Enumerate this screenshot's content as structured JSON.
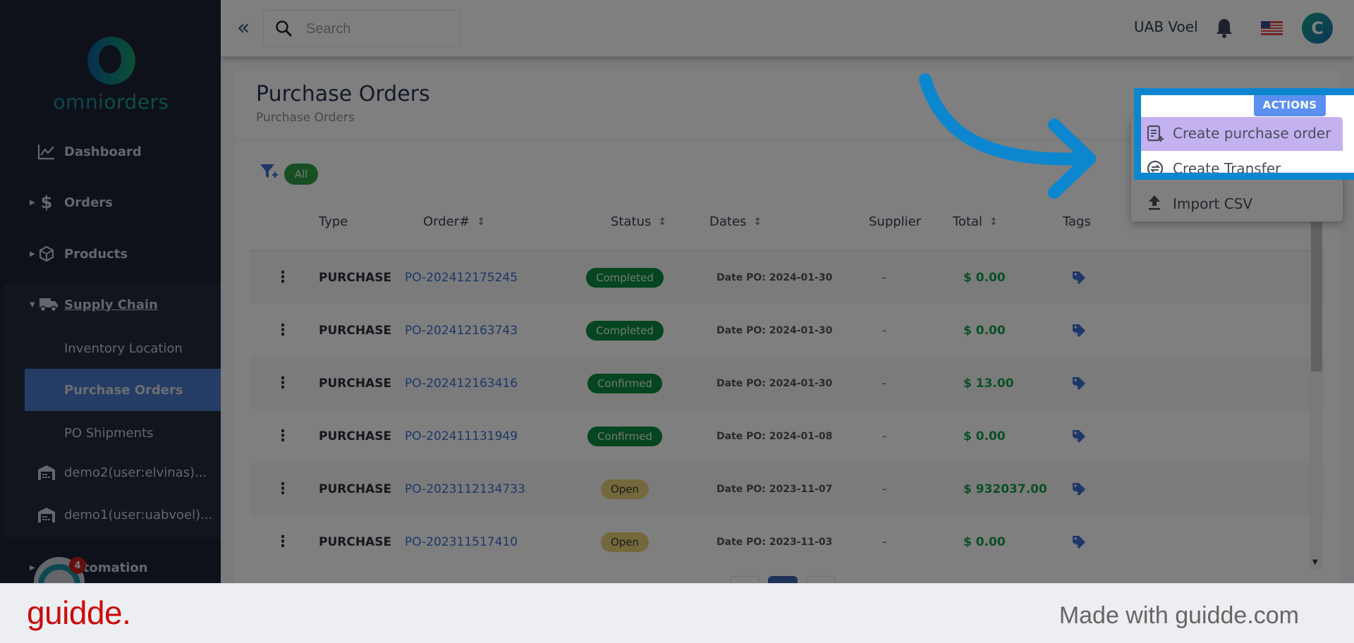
{
  "brand": {
    "logo_text_part1": "omni",
    "logo_text_part2": "orders"
  },
  "sidebar": {
    "items": [
      {
        "label": "Dashboard",
        "icon": "chart-line-icon"
      },
      {
        "label": "Orders",
        "icon": "dollar-icon"
      },
      {
        "label": "Products",
        "icon": "box-icon"
      },
      {
        "label": "Supply Chain",
        "icon": "truck-icon"
      },
      {
        "label": "Automation",
        "icon": "automation-icon"
      }
    ],
    "supply_chain_sub": [
      {
        "label": "Inventory Location"
      },
      {
        "label": "Purchase Orders",
        "active": true
      },
      {
        "label": "PO Shipments"
      },
      {
        "label": "demo2(user:elvinas)...",
        "icon": "warehouse-icon"
      },
      {
        "label": "demo1(user:uabvoel)...",
        "icon": "warehouse-icon"
      }
    ],
    "automation_badge": "4"
  },
  "topbar": {
    "search_placeholder": "Search",
    "user_name": "UAB Voel",
    "avatar_initial": "C",
    "language_flag": "us-flag"
  },
  "page": {
    "title": "Purchase Orders",
    "breadcrumb": "Purchase Orders",
    "filter_chip": "All",
    "actions_label": "ACTIONS"
  },
  "actions_menu": [
    {
      "label": "Create purchase order",
      "icon": "create-document-icon",
      "highlighted": true
    },
    {
      "label": "Create Transfer",
      "icon": "transfer-icon"
    },
    {
      "label": "Import CSV",
      "icon": "upload-icon"
    }
  ],
  "table": {
    "columns": [
      "Type",
      "Order#",
      "Status",
      "Dates",
      "Supplier",
      "Total",
      "Tags"
    ],
    "rows": [
      {
        "type": "PURCHASE",
        "order": "PO-202412175245",
        "status": "Completed",
        "status_color": "green",
        "date": "Date PO: 2024-01-30",
        "supplier": "-",
        "total": "$ 0.00"
      },
      {
        "type": "PURCHASE",
        "order": "PO-202412163743",
        "status": "Completed",
        "status_color": "green",
        "date": "Date PO: 2024-01-30",
        "supplier": "-",
        "total": "$ 0.00"
      },
      {
        "type": "PURCHASE",
        "order": "PO-202412163416",
        "status": "Confirmed",
        "status_color": "green",
        "date": "Date PO: 2024-01-30",
        "supplier": "-",
        "total": "$ 13.00"
      },
      {
        "type": "PURCHASE",
        "order": "PO-202411131949",
        "status": "Confirmed",
        "status_color": "green",
        "date": "Date PO: 2024-01-08",
        "supplier": "-",
        "total": "$ 0.00"
      },
      {
        "type": "PURCHASE",
        "order": "PO-2023112134733",
        "status": "Open",
        "status_color": "yellow",
        "date": "Date PO: 2023-11-07",
        "supplier": "-",
        "total": "$ 932037.00"
      },
      {
        "type": "PURCHASE",
        "order": "PO-202311517410",
        "status": "Open",
        "status_color": "yellow",
        "date": "Date PO: 2023-11-03",
        "supplier": "-",
        "total": "$ 0.00"
      }
    ]
  },
  "footer": {
    "logo": "guidde.",
    "made_with": "Made with guidde.com"
  },
  "colors": {
    "accent": "#0d86d0",
    "menu_highlight": "#c3b1f0",
    "actions_button": "#5b8ff0",
    "total_green": "#14a04a",
    "link_blue": "#3a6fd0"
  }
}
